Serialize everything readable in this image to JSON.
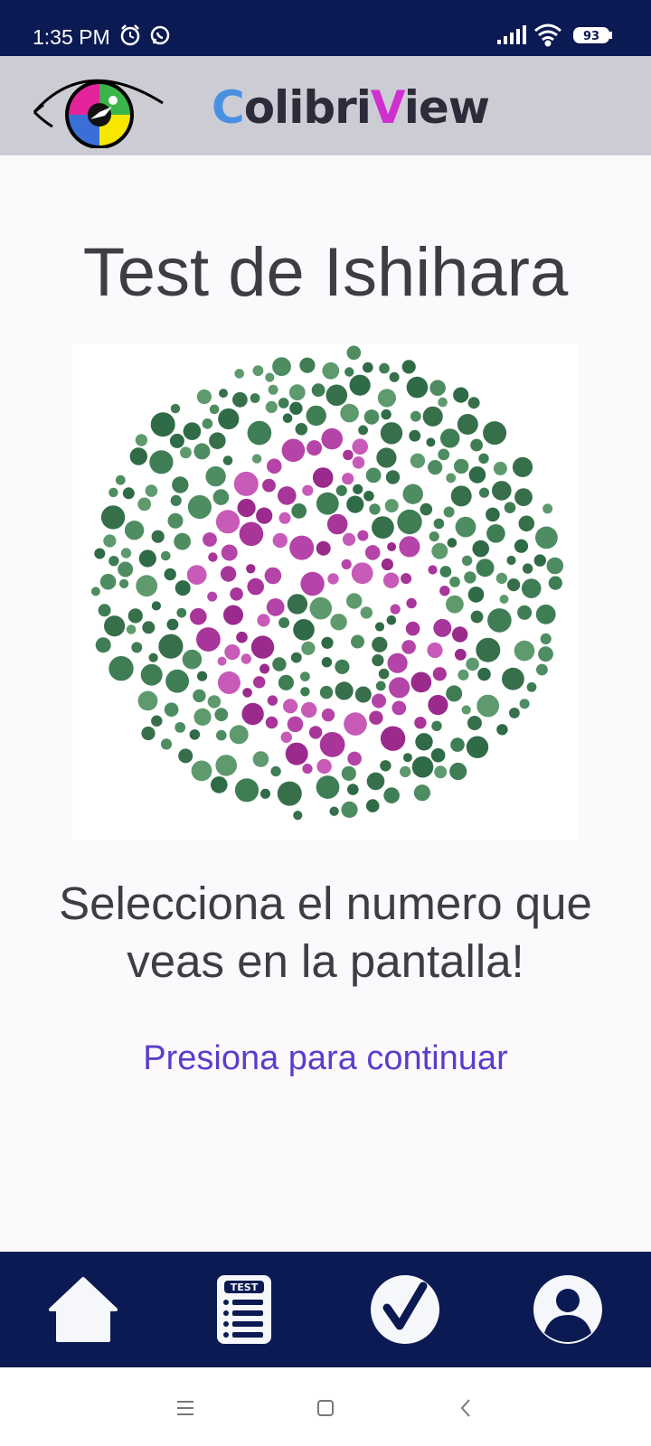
{
  "status_bar": {
    "time": "1:35 PM",
    "battery": "93",
    "left_icons": [
      "alarm-icon",
      "whatsapp-icon"
    ],
    "right_icons": [
      "signal-icon",
      "wifi-icon",
      "battery-icon"
    ]
  },
  "header": {
    "logo_icon": "eye-hummingbird-logo",
    "brand_part1": "C",
    "brand_part2": "olibri",
    "brand_part3": "V",
    "brand_part4": "iew"
  },
  "main": {
    "title": "Test de Ishihara",
    "instruction": "Selecciona el numero que veas en la pantalla!",
    "continue_link": "Presiona para continuar"
  },
  "plate": {
    "figure_colors": [
      "#9A2A8C",
      "#B544A8",
      "#C85AB8",
      "#A83599"
    ],
    "background_colors": [
      "#2F6B46",
      "#3F7D55",
      "#4E8C62",
      "#5E9A6E",
      "#376F4B"
    ]
  },
  "bottom_nav": {
    "items": [
      {
        "icon": "home-icon"
      },
      {
        "icon": "test-list-icon",
        "badge": "TEST"
      },
      {
        "icon": "check-circle-icon"
      },
      {
        "icon": "profile-icon"
      }
    ]
  },
  "system_nav": {
    "items": [
      "menu-icon",
      "home-square-icon",
      "back-icon"
    ]
  },
  "colors": {
    "navy": "#0B1A52",
    "header_gray": "#CCCCD4",
    "link": "#5A3ECB",
    "text": "#3E3D44"
  }
}
